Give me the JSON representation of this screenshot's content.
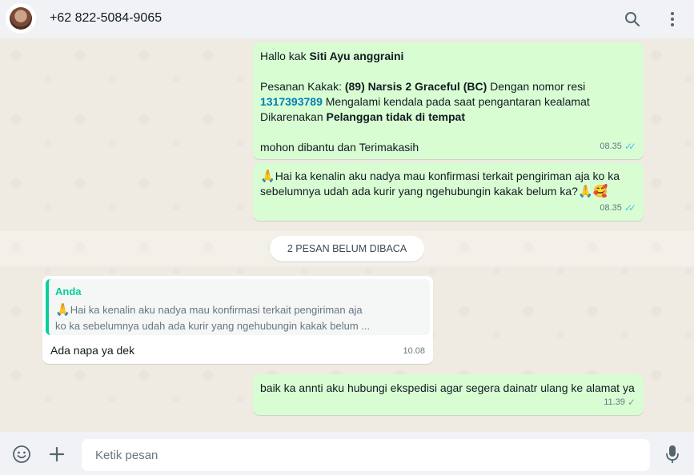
{
  "header": {
    "contact": "+62 822-5084-9065",
    "icons": [
      "avatar",
      "search-icon",
      "menu-icon"
    ]
  },
  "messages": {
    "m1": {
      "greeting": "Hallo kak ",
      "name": "Siti Ayu anggraini",
      "l2_prefix": "Pesanan Kakak: ",
      "l2_bold": "(89) Narsis 2 Graceful (BC)",
      "l2_suffix": " Dengan nomor resi",
      "resi": "1317393789",
      "l3_suffix": " Mengalami kendala pada saat pengantaran kealamat",
      "l4_prefix": "Dikarenakan ",
      "l4_bold": "Pelanggan tidak di tempat",
      "l5": " mohon dibantu dan Terimakasih",
      "time": "08.35"
    },
    "m2": {
      "line1": "Hai ka kenalin aku nadya mau konfirmasi terkait pengiriman aja ko ka",
      "line2": "sebelumnya udah ada kurir yang ngehubungin kakak belum ka?",
      "emoji_pray": "🙏",
      "emoji_love": "🥰",
      "time": "08.35"
    },
    "unread": "2 PESAN BELUM DIBACA",
    "m3": {
      "quote_author": "Anda",
      "quote_line1": "Hai ka kenalin aku nadya mau konfirmasi terkait pengiriman aja",
      "quote_line2": "ko ka sebelumnya udah ada kurir yang ngehubungin kakak belum ...",
      "text": "Ada napa ya dek",
      "time": "10.08"
    },
    "m4": {
      "text": "baik ka annti aku hubungi ekspedisi agar segera dainatr ulang ke alamat ya",
      "time": "11.39"
    }
  },
  "footer": {
    "placeholder": "Ketik pesan"
  },
  "colors": {
    "outgoing": "#d9fdd3",
    "incoming": "#ffffff",
    "read_tick": "#53bdeb",
    "quote_accent": "#06cf9c",
    "link": "#027eb5"
  }
}
